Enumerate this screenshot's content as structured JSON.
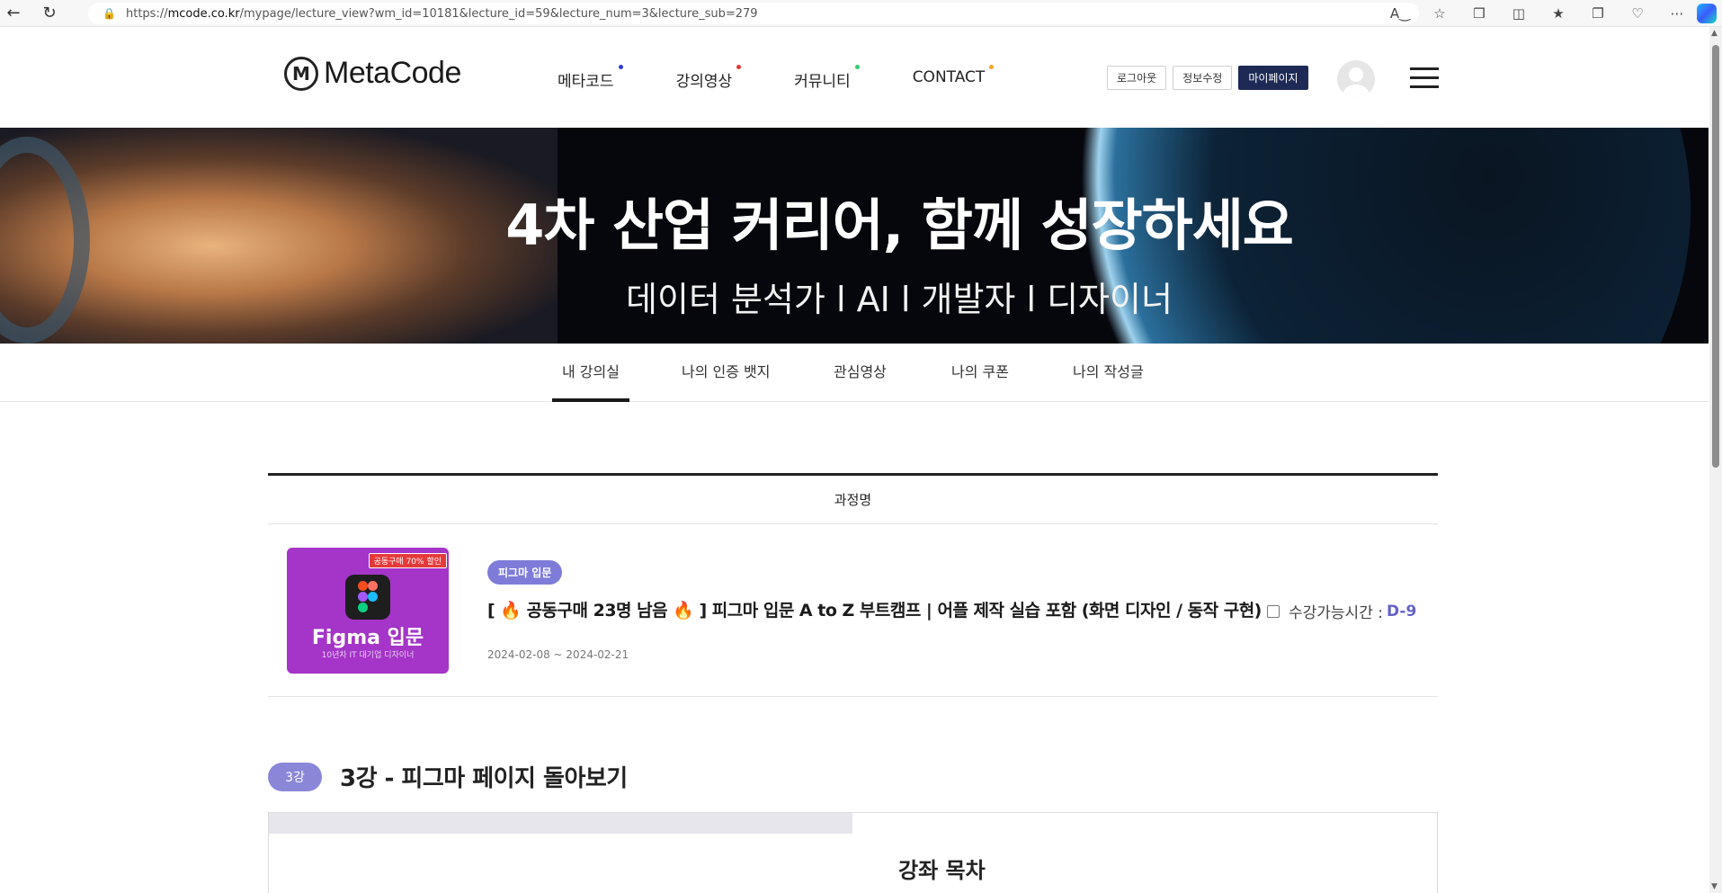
{
  "browser": {
    "url_prefix": "https://",
    "url_host": "mcode.co.kr",
    "url_path": "/mypage/lecture_view?wm_id=10181&lecture_id=59&lecture_num=3&lecture_sub=279"
  },
  "header": {
    "logo_text": "MetaCode",
    "logo_mark": "M",
    "nav": [
      {
        "label": "메타코드",
        "dot_color": "#2f3bd6"
      },
      {
        "label": "강의영상",
        "dot_color": "#e53935"
      },
      {
        "label": "커뮤니티",
        "dot_color": "#2ecc71"
      },
      {
        "label": "CONTACT",
        "dot_color": "#f5a623"
      }
    ],
    "logout_label": "로그아웃",
    "edit_info_label": "정보수정",
    "mypage_label": "마이페이지"
  },
  "banner": {
    "title": "4차 산업 커리어, 함께 성장하세요",
    "subtitle": "데이터 분석가 l  AI  l 개발자  l  디자이너"
  },
  "tabs": [
    {
      "label": "내 강의실",
      "active": true
    },
    {
      "label": "나의 인증 뱃지",
      "active": false
    },
    {
      "label": "관심영상",
      "active": false
    },
    {
      "label": "나의 쿠폰",
      "active": false
    },
    {
      "label": "나의 작성글",
      "active": false
    }
  ],
  "course": {
    "column_header": "과정명",
    "thumbnail": {
      "sale_badge": "공동구매 70% 할인",
      "title": "Figma 입문",
      "subtitle": "10년차 IT 대기업 디자이너"
    },
    "category_badge": "피그마 입문",
    "title": "[ 🔥 공동구매 23명 남음 🔥 ] 피그마 입문 A to Z 부트캠프 | 어플 제작 실습 포함 (화면 디자인 / 동작 구현)",
    "date_range": "2024-02-08 ~ 2024-02-21",
    "access_label": "수강가능시간 :",
    "access_value": "D-9"
  },
  "lecture": {
    "number_pill": "3강",
    "title": "3강 - 피그마 페이지 돌아보기"
  },
  "panel": {
    "toc_title": "강좌 목차"
  },
  "colors": {
    "accent": "#7e7cd8",
    "navy": "#1e2a55",
    "thumbnail": "#a534c8"
  }
}
